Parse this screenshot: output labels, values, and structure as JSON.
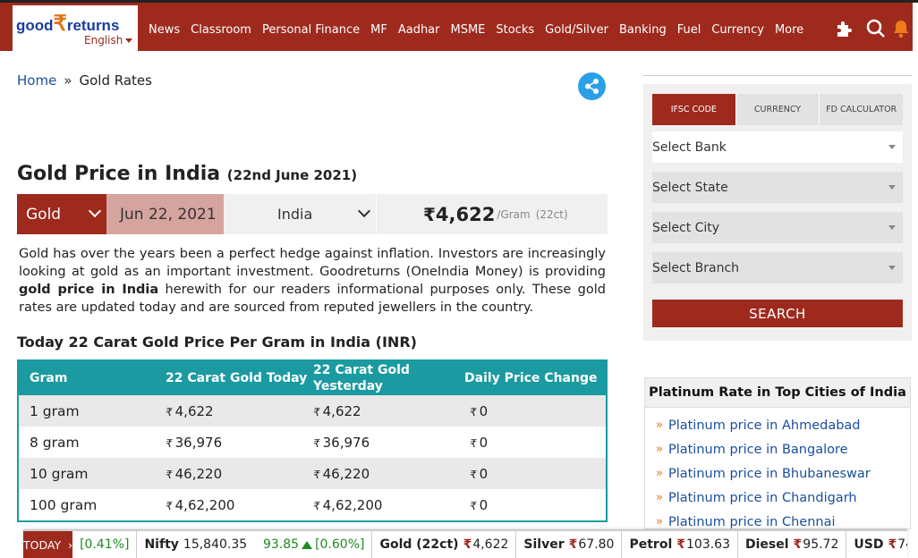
{
  "header": {
    "logo_good": "good",
    "logo_returns": "returns",
    "logo_language": "English",
    "nav": [
      "News",
      "Classroom",
      "Personal Finance",
      "MF",
      "Aadhar",
      "MSME",
      "Stocks",
      "Gold/Silver",
      "Banking",
      "Fuel",
      "Currency",
      "More"
    ]
  },
  "breadcrumb": {
    "home": "Home",
    "separator": "»",
    "current": "Gold Rates"
  },
  "title": {
    "main": "Gold Price in India",
    "date": "(22nd June 2021)"
  },
  "filter": {
    "metal": "Gold",
    "date": "Jun 22, 2021",
    "country": "India",
    "price_symbol": "₹",
    "price": "4,622",
    "unit": "/Gram",
    "carat": "(22ct)"
  },
  "description": {
    "part1": "Gold has over the years been a perfect hedge against inflation. Investors are increasingly looking at gold as an important investment. Goodreturns (OneIndia Money) is providing ",
    "bold": "gold price in India",
    "part2": " herewith for our readers informational purposes only. These gold rates are updated today and are sourced from reputed jewellers in the country."
  },
  "table": {
    "title": "Today 22 Carat Gold Price Per Gram in India (INR)",
    "headers": [
      "Gram",
      "22 Carat Gold Today",
      "22 Carat Gold Yesterday",
      "Daily Price Change"
    ],
    "rows": [
      [
        "1 gram",
        "4,622",
        "4,622",
        "0"
      ],
      [
        "8 gram",
        "36,976",
        "36,976",
        "0"
      ],
      [
        "10 gram",
        "46,220",
        "46,220",
        "0"
      ],
      [
        "100 gram",
        "4,62,200",
        "4,62,200",
        "0"
      ]
    ],
    "currency_symbol": "₹"
  },
  "sidebar": {
    "tabs": [
      "IFSC CODE",
      "CURRENCY",
      "FD CALCULATOR"
    ],
    "selects": [
      "Select Bank",
      "Select State",
      "Select City",
      "Select Branch"
    ],
    "search": "SEARCH"
  },
  "platinum": {
    "title": "Platinum Rate in Top Cities of India",
    "links": [
      "Platinum price in Ahmedabad",
      "Platinum price in Bangalore",
      "Platinum price in Bhubaneswar",
      "Platinum price in Chandigarh",
      "Platinum price in Chennai"
    ]
  },
  "ticker": {
    "today": "TODAY",
    "prev_pct": "[0.41%]",
    "nifty_label": "Nifty",
    "nifty_value": "15,840.35",
    "nifty_change": "93.85",
    "nifty_pct": "[0.60%]",
    "gold_label": "Gold (22ct)",
    "gold_value": "4,622",
    "silver_label": "Silver",
    "silver_value": "67.80",
    "petrol_label": "Petrol",
    "petrol_value": "103.63",
    "diesel_label": "Diesel",
    "diesel_value": "95.72",
    "usd_label": "USD",
    "usd_value": "74.",
    "rupee": "₹"
  },
  "colors": {
    "brand": "#9e2a1e",
    "table_accent": "#1b9aa1",
    "link": "#1a4f9c",
    "share": "#2aa0e8",
    "positive": "#1f8a1f"
  }
}
